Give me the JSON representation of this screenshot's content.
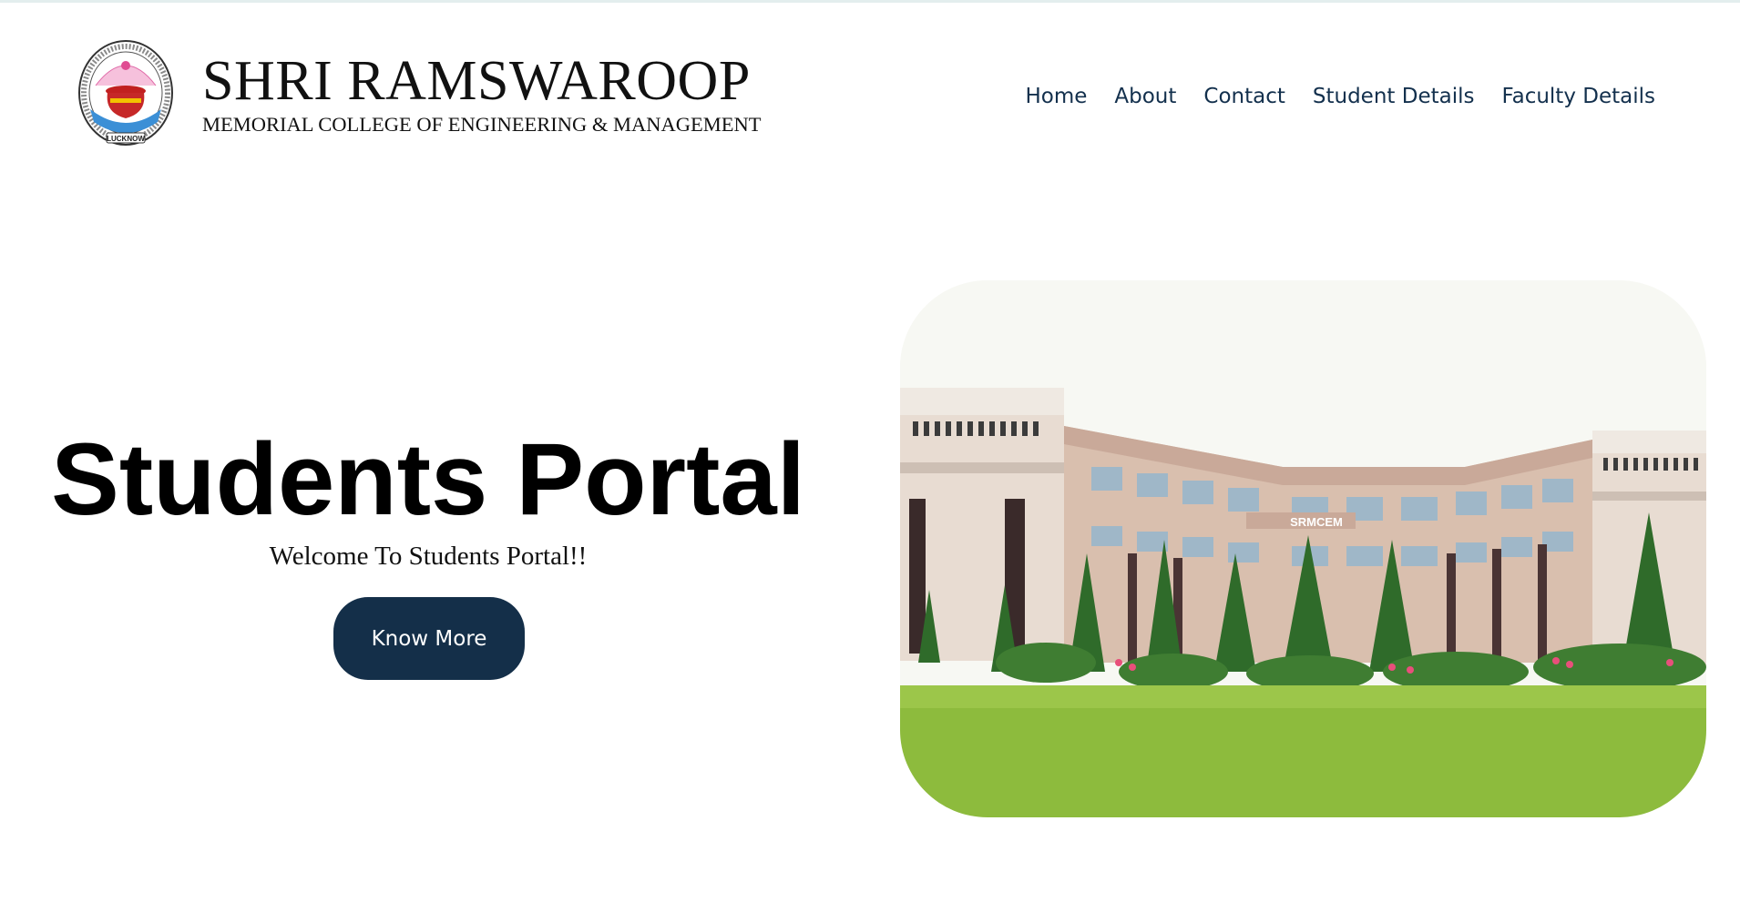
{
  "header": {
    "brand_title": "SHRI RAMSWAROOP",
    "brand_subtitle": "MEMORIAL COLLEGE OF ENGINEERING & MANAGEMENT",
    "logo_city": "LUCKNOW"
  },
  "nav": {
    "items": [
      {
        "label": "Home"
      },
      {
        "label": "About"
      },
      {
        "label": "Contact"
      },
      {
        "label": "Student Details"
      },
      {
        "label": "Faculty Details"
      }
    ]
  },
  "hero": {
    "title": "Students Portal",
    "subtitle": "Welcome To Students Portal!!",
    "button_label": "Know More",
    "image_sign": "SRMCEM"
  },
  "colors": {
    "nav_text": "#13304d",
    "button_bg": "#142f49",
    "lawn": "#8dbb3d",
    "building": "#d9bfae"
  }
}
